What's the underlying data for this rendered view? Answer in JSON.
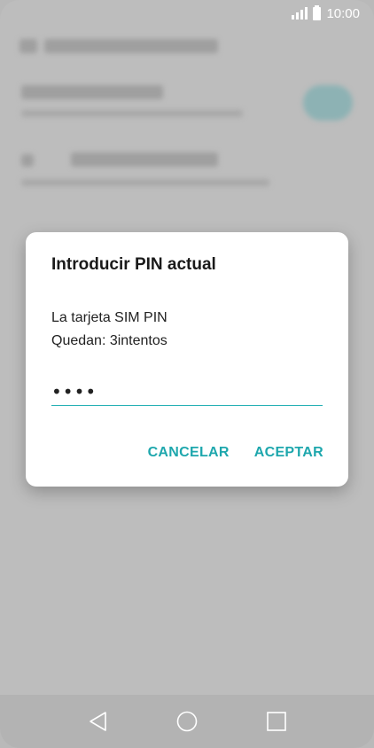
{
  "status_bar": {
    "time": "10:00",
    "icons": [
      "signal-icon",
      "battery-icon"
    ]
  },
  "dialog": {
    "title": "Introducir PIN actual",
    "message_line1": "La tarjeta SIM PIN",
    "message_line2": "Quedan: 3intentos",
    "pin_value": "••••",
    "cancel_label": "CANCELAR",
    "accept_label": "ACEPTAR"
  },
  "nav_bar": {
    "icons": [
      "back-icon",
      "home-icon",
      "recents-icon"
    ]
  },
  "colors": {
    "accent": "#1ea7ad",
    "underline": "#26b1b5",
    "scrim": "#bdbdbd"
  }
}
